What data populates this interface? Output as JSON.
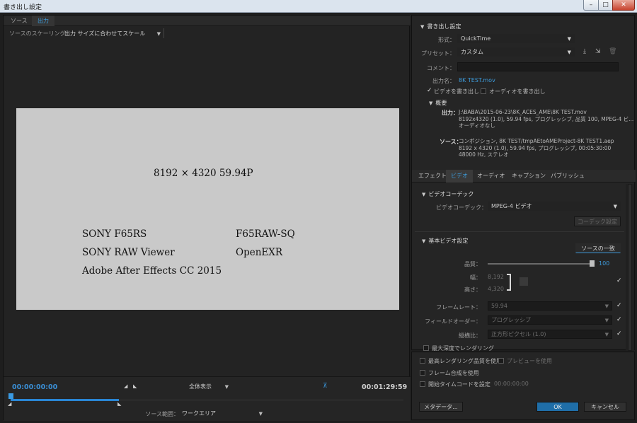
{
  "window": {
    "title": "書き出し設定",
    "min": "–",
    "max": "□",
    "close": "✕"
  },
  "left": {
    "tabs": [
      "ソース",
      "出力"
    ],
    "scaling_label": "ソースのスケーリング：",
    "scaling_value": "出力 サイズに合わせてスケール",
    "preview_lines": [
      "8192 × 4320  59.94P",
      "SONY  F65RS",
      "F65RAW-SQ",
      "SONY  RAW Viewer",
      "OpenEXR",
      "Adobe After Effects CC 2015"
    ],
    "timeline": {
      "timecode_in": "00:00:00:00",
      "timecode_out": "00:01:29:59",
      "fit_value": "全体表示",
      "range_label": "ソース範囲：",
      "range_value": "ワークエリア"
    }
  },
  "export": {
    "heading": "書き出し設定",
    "format_label": "形式：",
    "format_value": "QuickTime",
    "preset_label": "プリセット：",
    "preset_value": "カスタム",
    "comment_label": "コメント：",
    "output_label": "出力名：",
    "output_value": "8K TEST.mov",
    "export_video": "ビデオを書き出し",
    "export_audio": "オーディオを書き出し",
    "summary_heading": "概要",
    "output_key": "出力：",
    "output_lines": [
      "J:\\BABA\\2015-06-23\\8K_ACES_AME\\8K TEST.mov",
      "8192x4320 (1.0), 59.94 fps, プログレッシブ, 品質 100, MPEG-4 ビ...",
      "オーディオなし"
    ],
    "source_key": "ソース：",
    "source_lines": [
      "コンポジション, 8K TEST/tmpAEtoAMEProject-8K TEST1.aep",
      "8192 x 4320 (1.0), 59.94 fps, プログレッシブ, 00:05:30:00",
      "48000 Hz, ステレオ"
    ]
  },
  "tabs": [
    "エフェクト",
    "ビデオ",
    "オーディオ",
    "キャプション",
    "パブリッシュ"
  ],
  "video": {
    "codec_heading": "ビデオコーデック",
    "codec_label": "ビデオコーデック：",
    "codec_value": "MPEG-4 ビデオ",
    "codec_settings": "コーデック設定",
    "basic_heading": "基本ビデオ設定",
    "match_source": "ソースの一致",
    "quality_label": "品質：",
    "quality_value": "100",
    "quality_fraction": 1.0,
    "width_label": "幅：",
    "width_value": "8,192",
    "height_label": "高さ：",
    "height_value": "4,320",
    "framerate_label": "フレームレート：",
    "framerate_value": "59.94",
    "field_label": "フィールドオーダー：",
    "field_value": "プログレッシブ",
    "aspect_label": "縦横比：",
    "aspect_value": "正方形ピクセル (1.0)",
    "max_depth": "最大深度でレンダリング"
  },
  "bottom": {
    "max_render": "最高レンダリング品質を使用",
    "use_preview": "プレビューを使用",
    "frame_blend": "フレーム合成を使用",
    "start_tc_label": "開始タイムコードを設定",
    "start_tc_value": "00:00:00:00",
    "metadata": "メタデータ...",
    "ok": "OK",
    "cancel": "キャンセル"
  }
}
